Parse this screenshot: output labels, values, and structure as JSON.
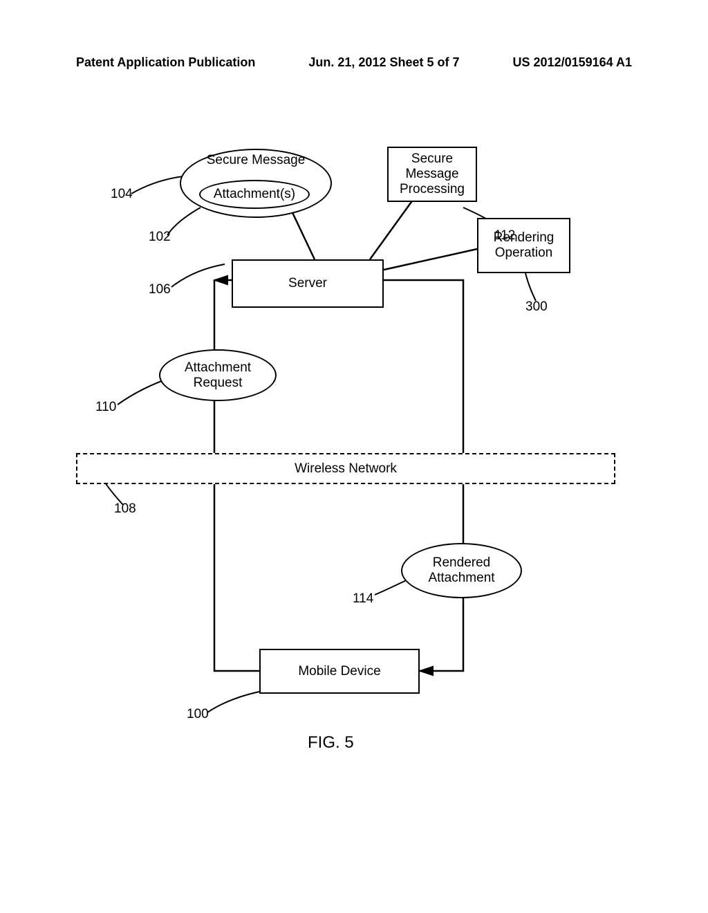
{
  "header": {
    "left": "Patent Application Publication",
    "mid": "Jun. 21, 2012  Sheet 5 of 7",
    "right": "US 2012/0159164 A1"
  },
  "diagram": {
    "secure_message": "Secure Message",
    "attachments": "Attachment(s)",
    "secure_msg_proc": "Secure\nMessage\nProcessing",
    "rendering_op": "Rendering\nOperation",
    "server": "Server",
    "attach_req": "Attachment\nRequest",
    "wireless": "Wireless Network",
    "rendered_att": "Rendered\nAttachment",
    "mobile_dev": "Mobile Device",
    "fig": "FIG. 5",
    "ref": {
      "r104": "104",
      "r102": "102",
      "r112": "112",
      "r106": "106",
      "r300": "300",
      "r110": "110",
      "r108": "108",
      "r114": "114",
      "r100": "100"
    }
  }
}
